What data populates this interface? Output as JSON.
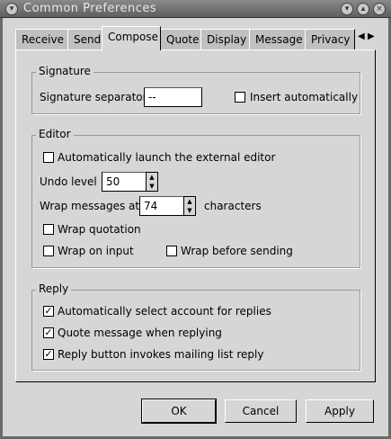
{
  "window": {
    "title": "Common Preferences",
    "icons": [
      "window-menu-icon",
      "minimize-icon",
      "maximize-icon",
      "close-icon"
    ]
  },
  "tabs": [
    "Receive",
    "Send",
    "Compose",
    "Quote",
    "Display",
    "Message",
    "Privacy"
  ],
  "active_tab": "Compose",
  "signature": {
    "title": "Signature",
    "separator_label": "Signature separator",
    "separator_value": "--",
    "insert_auto_label": "Insert automatically",
    "insert_auto_checked": false
  },
  "editor": {
    "title": "Editor",
    "auto_launch_label": "Automatically launch the external editor",
    "auto_launch_checked": false,
    "undo_label": "Undo level",
    "undo_value": "50",
    "wrap_label": "Wrap messages at",
    "wrap_value": "74",
    "wrap_unit": "characters",
    "wrap_quotation_label": "Wrap quotation",
    "wrap_quotation_checked": false,
    "wrap_input_label": "Wrap on input",
    "wrap_input_checked": false,
    "wrap_before_label": "Wrap before sending",
    "wrap_before_checked": false
  },
  "reply": {
    "title": "Reply",
    "auto_select_label": "Automatically select account for replies",
    "quote_label": "Quote message when replying",
    "mailing_label": "Reply button invokes mailing list reply",
    "check_mark": "✓"
  },
  "buttons": {
    "ok": "OK",
    "cancel": "Cancel",
    "apply": "Apply"
  }
}
